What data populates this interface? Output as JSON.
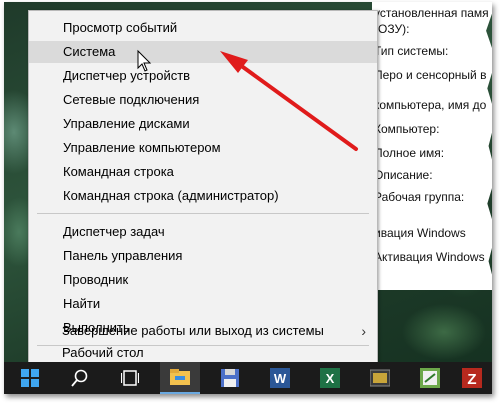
{
  "menu": {
    "items": [
      {
        "label": "Просмотр событий"
      },
      {
        "label": "Система"
      },
      {
        "label": "Диспетчер устройств"
      },
      {
        "label": "Сетевые подключения"
      },
      {
        "label": "Управление дисками"
      },
      {
        "label": "Управление компьютером"
      },
      {
        "label": "Командная строка"
      },
      {
        "label": "Командная строка (администратор)"
      },
      {
        "label": "Диспетчер задач"
      },
      {
        "label": "Панель управления"
      },
      {
        "label": "Проводник"
      },
      {
        "label": "Найти"
      },
      {
        "label": "Выполнить"
      },
      {
        "label": "Завершение работы или выход из системы"
      },
      {
        "label": "Рабочий стол"
      }
    ],
    "submenu_arrow": "›"
  },
  "sysinfo": {
    "lines": [
      "установленная памя",
      "(ОЗУ):",
      "Тип системы:",
      "Перо и сенсорный в",
      "компьютера, имя до",
      "Компьютер:",
      "Полное имя:",
      "Описание:",
      "Рабочая группа:",
      "ивация Windows",
      "Активация Windows"
    ]
  },
  "taskbar": {
    "icons": [
      "start-icon",
      "search-icon",
      "task-view-icon",
      "file-explorer-icon",
      "floppy-icon",
      "word-icon",
      "excel-icon",
      "app-icon",
      "app-icon-2",
      "filezilla-icon"
    ],
    "word_letter": "W",
    "excel_letter": "X",
    "filezilla_letter": "Z"
  },
  "colors": {
    "menu_bg": "#f2f2f2",
    "menu_hover": "#dadada",
    "arrow": "#e01b1b",
    "taskbar": "#1b1b1b"
  }
}
